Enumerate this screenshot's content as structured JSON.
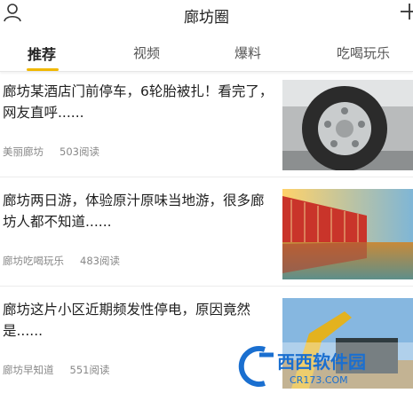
{
  "header": {
    "title": "廊坊圈"
  },
  "tabs": [
    {
      "label": "推荐"
    },
    {
      "label": "视频"
    },
    {
      "label": "爆料"
    },
    {
      "label": "吃喝玩乐"
    }
  ],
  "articles": [
    {
      "title": "廊坊某酒店门前停车，6轮胎被扎！看完了，网友直呼......",
      "source": "美丽廊坊",
      "views": "503阅读",
      "image": "tire-photo"
    },
    {
      "title": "廊坊两日游，体验原汁原味当地游，很多廊坊人都不知道......",
      "source": "廊坊吃喝玩乐",
      "views": "483阅读",
      "image": "building-water-photo"
    },
    {
      "title": "廊坊这片小区近期频发性停电，原因竟然是......",
      "source": "廊坊早知道",
      "views": "551阅读",
      "image": "excavator-photo"
    }
  ],
  "watermark": {
    "text": "西西软件园",
    "url": "CR173.COM"
  },
  "colors": {
    "accent": "#f1b800",
    "text": "#1f1f1f",
    "meta": "#888888"
  }
}
